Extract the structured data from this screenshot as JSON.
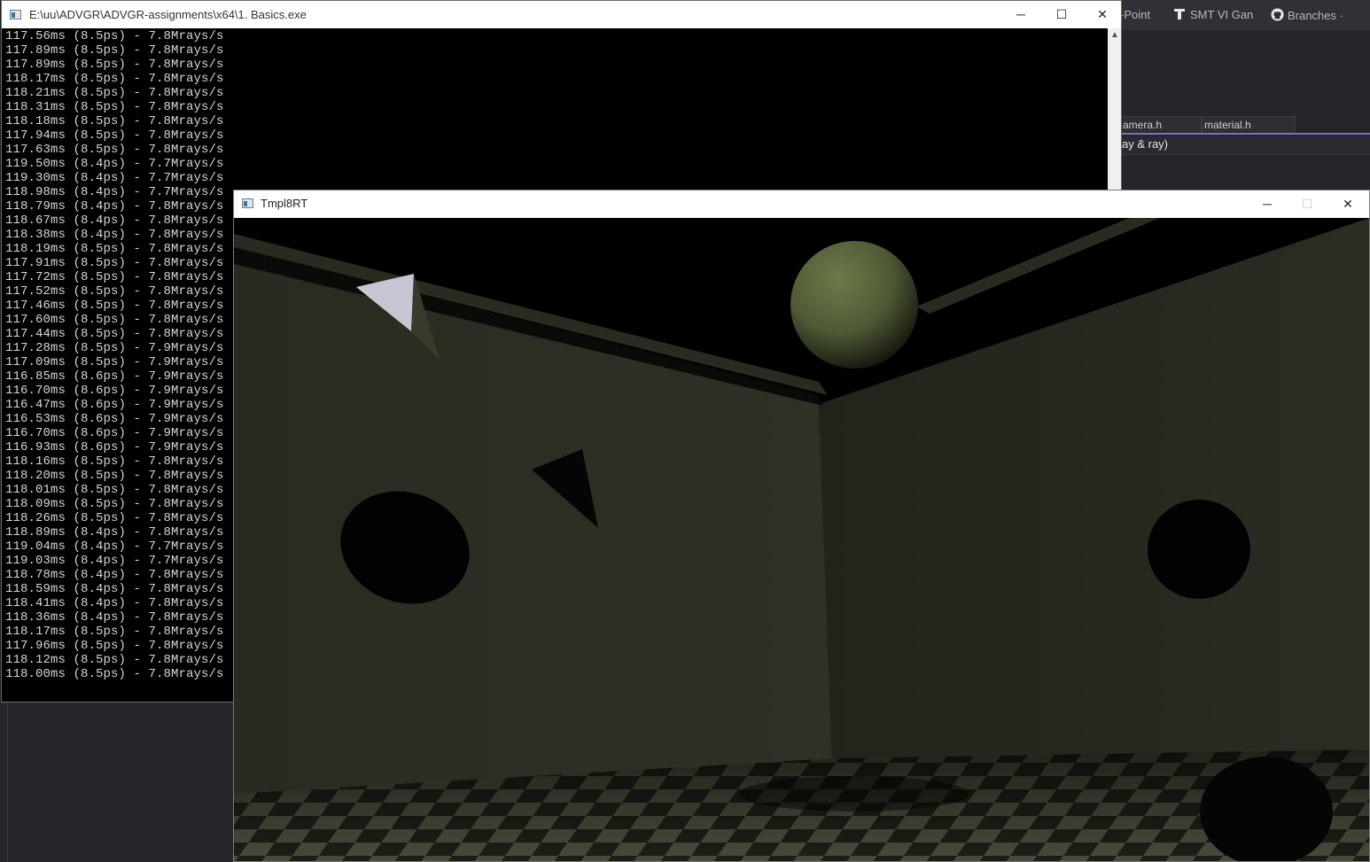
{
  "console": {
    "title": "E:\\uu\\ADVGR\\ADVGR-assignments\\x64\\1. Basics.exe",
    "lines": [
      "117.56ms (8.5ps) - 7.8Mrays/s",
      "117.89ms (8.5ps) - 7.8Mrays/s",
      "117.89ms (8.5ps) - 7.8Mrays/s",
      "118.17ms (8.5ps) - 7.8Mrays/s",
      "118.21ms (8.5ps) - 7.8Mrays/s",
      "118.31ms (8.5ps) - 7.8Mrays/s",
      "118.18ms (8.5ps) - 7.8Mrays/s",
      "117.94ms (8.5ps) - 7.8Mrays/s",
      "117.63ms (8.5ps) - 7.8Mrays/s",
      "119.50ms (8.4ps) - 7.7Mrays/s",
      "119.30ms (8.4ps) - 7.7Mrays/s",
      "118.98ms (8.4ps) - 7.7Mrays/s",
      "118.79ms (8.4ps) - 7.8Mrays/s",
      "118.67ms (8.4ps) - 7.8Mrays/s",
      "118.38ms (8.4ps) - 7.8Mrays/s",
      "118.19ms (8.5ps) - 7.8Mrays/s",
      "117.91ms (8.5ps) - 7.8Mrays/s",
      "117.72ms (8.5ps) - 7.8Mrays/s",
      "117.52ms (8.5ps) - 7.8Mrays/s",
      "117.46ms (8.5ps) - 7.8Mrays/s",
      "117.60ms (8.5ps) - 7.8Mrays/s",
      "117.44ms (8.5ps) - 7.8Mrays/s",
      "117.28ms (8.5ps) - 7.9Mrays/s",
      "117.09ms (8.5ps) - 7.9Mrays/s",
      "116.85ms (8.6ps) - 7.9Mrays/s",
      "116.70ms (8.6ps) - 7.9Mrays/s",
      "116.47ms (8.6ps) - 7.9Mrays/s",
      "116.53ms (8.6ps) - 7.9Mrays/s",
      "116.70ms (8.6ps) - 7.9Mrays/s",
      "116.93ms (8.6ps) - 7.9Mrays/s",
      "118.16ms (8.5ps) - 7.8Mrays/s",
      "118.20ms (8.5ps) - 7.8Mrays/s",
      "118.01ms (8.5ps) - 7.8Mrays/s",
      "118.09ms (8.5ps) - 7.8Mrays/s",
      "118.26ms (8.5ps) - 7.8Mrays/s",
      "118.89ms (8.4ps) - 7.8Mrays/s",
      "119.04ms (8.4ps) - 7.7Mrays/s",
      "119.03ms (8.4ps) - 7.7Mrays/s",
      "118.78ms (8.4ps) - 7.8Mrays/s",
      "118.59ms (8.4ps) - 7.8Mrays/s",
      "118.41ms (8.4ps) - 7.8Mrays/s",
      "118.36ms (8.4ps) - 7.8Mrays/s",
      "118.17ms (8.5ps) - 7.8Mrays/s",
      "117.96ms (8.5ps) - 7.8Mrays/s",
      "118.12ms (8.5ps) - 7.8Mrays/s",
      "118.00ms (8.5ps) - 7.8Mrays/s"
    ]
  },
  "render": {
    "title": "Tmpl8RT"
  },
  "window_controls": {
    "minimize": "─",
    "maximize": "☐",
    "close": "✕"
  },
  "ide": {
    "bookmarks": [
      {
        "label": "-Point",
        "icon": "powerpoint-icon"
      },
      {
        "label": "SMT VI Gan",
        "icon": "tudelft-icon"
      },
      {
        "label": "Branches ·",
        "icon": "github-icon"
      }
    ],
    "tabs": [
      "amera.h",
      "material.h"
    ],
    "code_line": "ay & ray)"
  },
  "colors": {
    "accent_purple": "#7f6ad6",
    "accent_blue": "#2f89d8",
    "wall_left": "#2b2b22",
    "wall_right": "#26261e",
    "sphere_green": "#5e6b42"
  }
}
